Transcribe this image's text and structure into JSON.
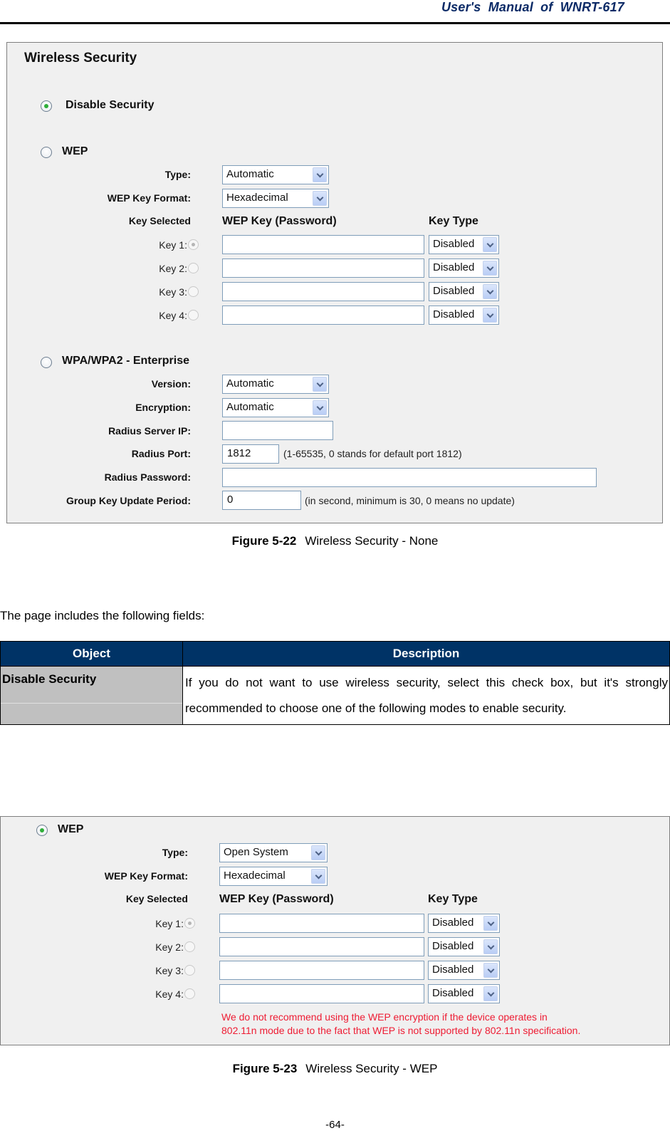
{
  "header": {
    "title": "User's  Manual  of  WNRT-617"
  },
  "figure1": {
    "page_heading": "Wireless Security",
    "disable_security": {
      "label": "Disable Security",
      "selected": true
    },
    "wep": {
      "label": "WEP",
      "selected": false,
      "type_label": "Type:",
      "type_value": "Automatic",
      "key_format_label": "WEP Key Format:",
      "key_format_value": "Hexadecimal",
      "col_key_selected": "Key Selected",
      "col_wep_key": "WEP Key (Password)",
      "col_key_type": "Key Type",
      "keys": [
        {
          "label": "Key 1:",
          "selected": true,
          "value": "",
          "type": "Disabled"
        },
        {
          "label": "Key 2:",
          "selected": false,
          "value": "",
          "type": "Disabled"
        },
        {
          "label": "Key 3:",
          "selected": false,
          "value": "",
          "type": "Disabled"
        },
        {
          "label": "Key 4:",
          "selected": false,
          "value": "",
          "type": "Disabled"
        }
      ]
    },
    "wpa_enterprise": {
      "label": "WPA/WPA2 - Enterprise",
      "selected": false,
      "version_label": "Version:",
      "version_value": "Automatic",
      "encryption_label": "Encryption:",
      "encryption_value": "Automatic",
      "radius_ip_label": "Radius Server IP:",
      "radius_ip_value": "",
      "radius_port_label": "Radius Port:",
      "radius_port_value": "1812",
      "radius_port_hint": "(1-65535, 0 stands for default port 1812)",
      "radius_password_label": "Radius Password:",
      "radius_password_value": "",
      "group_key_label": "Group Key Update Period:",
      "group_key_value": "0",
      "group_key_hint": "(in second, minimum is 30, 0 means no update)"
    },
    "caption_num": "Figure 5-22",
    "caption_text": "Wireless Security - None"
  },
  "intro": "The page includes the following fields:",
  "table": {
    "headers": [
      "Object",
      "Description"
    ],
    "rows": [
      {
        "object": "Disable Security",
        "description": "If you do not want to use wireless security, select this check box, but it's strongly recommended to choose one of the following modes to enable security."
      }
    ]
  },
  "figure2": {
    "wep": {
      "label": "WEP",
      "selected": true,
      "type_label": "Type:",
      "type_value": "Open System",
      "key_format_label": "WEP Key Format:",
      "key_format_value": "Hexadecimal",
      "col_key_selected": "Key Selected",
      "col_wep_key": "WEP Key (Password)",
      "col_key_type": "Key Type",
      "keys": [
        {
          "label": "Key 1:",
          "selected": true,
          "value": "",
          "type": "Disabled"
        },
        {
          "label": "Key 2:",
          "selected": false,
          "value": "",
          "type": "Disabled"
        },
        {
          "label": "Key 3:",
          "selected": false,
          "value": "",
          "type": "Disabled"
        },
        {
          "label": "Key 4:",
          "selected": false,
          "value": "",
          "type": "Disabled"
        }
      ],
      "warning_line1": "We do not recommend using the WEP encryption if the device operates in",
      "warning_line2": "802.11n mode due to the fact that WEP is not supported by 802.11n specification."
    },
    "caption_num": "Figure 5-23",
    "caption_text": "Wireless Security - WEP"
  },
  "footer": {
    "page_number": "-64-"
  },
  "colors": {
    "header_text": "#0b2a66",
    "table_header_bg": "#003366",
    "object_cell_bg": "#c0c0c0",
    "warning_text": "#ee1c33",
    "radio_selected": "#2fae3a"
  }
}
